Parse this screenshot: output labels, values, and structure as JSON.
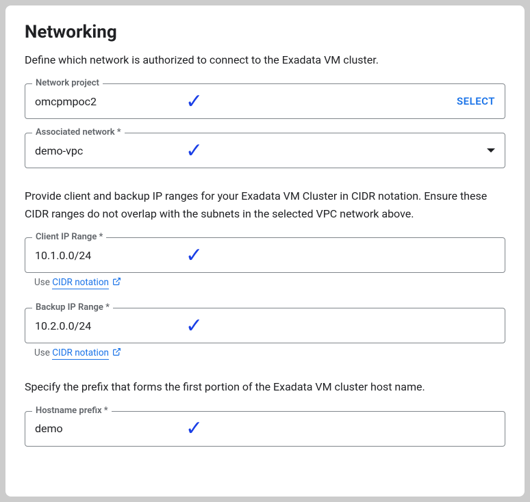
{
  "heading": "Networking",
  "description": "Define which network is authorized to connect to the Exadata VM cluster.",
  "network_project": {
    "label": "Network project",
    "value": "omcpmpoc2",
    "select_label": "SELECT"
  },
  "associated_network": {
    "label": "Associated network *",
    "value": "demo-vpc"
  },
  "ip_paragraph": "Provide client and backup IP ranges for your Exadata VM Cluster in CIDR notation. Ensure these CIDR ranges do not overlap with the subnets in the selected VPC network above.",
  "client_ip": {
    "label": "Client IP Range *",
    "value": "10.1.0.0/24",
    "helper_prefix": "Use ",
    "helper_link": "CIDR notation"
  },
  "backup_ip": {
    "label": "Backup IP Range *",
    "value": "10.2.0.0/24",
    "helper_prefix": "Use ",
    "helper_link": "CIDR notation"
  },
  "hostname_paragraph": "Specify the prefix that forms the first portion of the Exadata VM cluster host name.",
  "hostname_prefix": {
    "label": "Hostname prefix *",
    "value": "demo"
  }
}
